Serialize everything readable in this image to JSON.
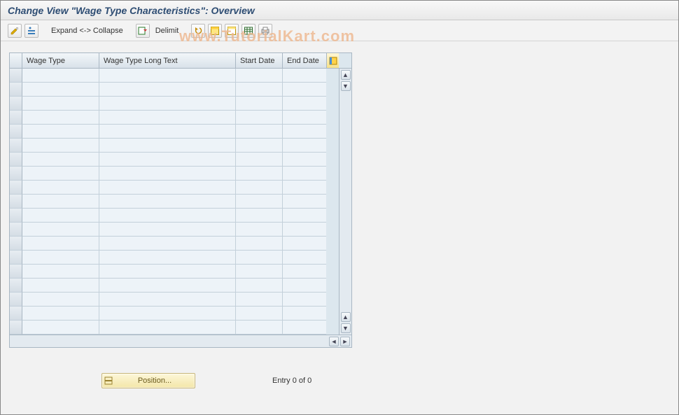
{
  "title": "Change View \"Wage Type Characteristics\": Overview",
  "toolbar": {
    "expand_collapse": "Expand <-> Collapse",
    "delimit": "Delimit"
  },
  "columns": {
    "wage_type": "Wage Type",
    "wage_type_long": "Wage Type Long Text",
    "start_date": "Start Date",
    "end_date": "End Date"
  },
  "rows": [
    {
      "wage_type": "",
      "wage_type_long": "",
      "start_date": "",
      "end_date": ""
    },
    {
      "wage_type": "",
      "wage_type_long": "",
      "start_date": "",
      "end_date": ""
    },
    {
      "wage_type": "",
      "wage_type_long": "",
      "start_date": "",
      "end_date": ""
    },
    {
      "wage_type": "",
      "wage_type_long": "",
      "start_date": "",
      "end_date": ""
    },
    {
      "wage_type": "",
      "wage_type_long": "",
      "start_date": "",
      "end_date": ""
    },
    {
      "wage_type": "",
      "wage_type_long": "",
      "start_date": "",
      "end_date": ""
    },
    {
      "wage_type": "",
      "wage_type_long": "",
      "start_date": "",
      "end_date": ""
    },
    {
      "wage_type": "",
      "wage_type_long": "",
      "start_date": "",
      "end_date": ""
    },
    {
      "wage_type": "",
      "wage_type_long": "",
      "start_date": "",
      "end_date": ""
    },
    {
      "wage_type": "",
      "wage_type_long": "",
      "start_date": "",
      "end_date": ""
    },
    {
      "wage_type": "",
      "wage_type_long": "",
      "start_date": "",
      "end_date": ""
    },
    {
      "wage_type": "",
      "wage_type_long": "",
      "start_date": "",
      "end_date": ""
    },
    {
      "wage_type": "",
      "wage_type_long": "",
      "start_date": "",
      "end_date": ""
    },
    {
      "wage_type": "",
      "wage_type_long": "",
      "start_date": "",
      "end_date": ""
    },
    {
      "wage_type": "",
      "wage_type_long": "",
      "start_date": "",
      "end_date": ""
    },
    {
      "wage_type": "",
      "wage_type_long": "",
      "start_date": "",
      "end_date": ""
    },
    {
      "wage_type": "",
      "wage_type_long": "",
      "start_date": "",
      "end_date": ""
    },
    {
      "wage_type": "",
      "wage_type_long": "",
      "start_date": "",
      "end_date": ""
    },
    {
      "wage_type": "",
      "wage_type_long": "",
      "start_date": "",
      "end_date": ""
    }
  ],
  "footer": {
    "position_label": "Position...",
    "entry_status": "Entry 0 of 0"
  },
  "watermark": "www.TutorialKart.com"
}
